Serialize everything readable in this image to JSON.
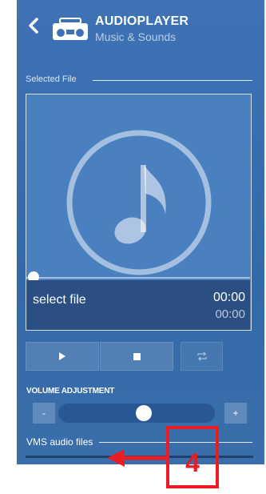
{
  "header": {
    "title": "AUDIOPLAYER",
    "subtitle": "Music & Sounds"
  },
  "selected_file": {
    "legend": "Selected File",
    "file_label": "select file",
    "time_current": "00:00",
    "time_total": "00:00",
    "progress": 0
  },
  "controls": {
    "buttons": [
      "play-icon",
      "stop-icon",
      "repeat-icon"
    ]
  },
  "volume": {
    "label": "VOLUME ADJUSTMENT",
    "minus_label": "-",
    "plus_label": "+",
    "level": 0.55
  },
  "vms": {
    "legend": "VMS audio files"
  },
  "annotation": {
    "number": "4",
    "color": "#ea1c24"
  },
  "colors": {
    "panel": "#3e72b5",
    "bottom_bar": "#2b4f83"
  }
}
